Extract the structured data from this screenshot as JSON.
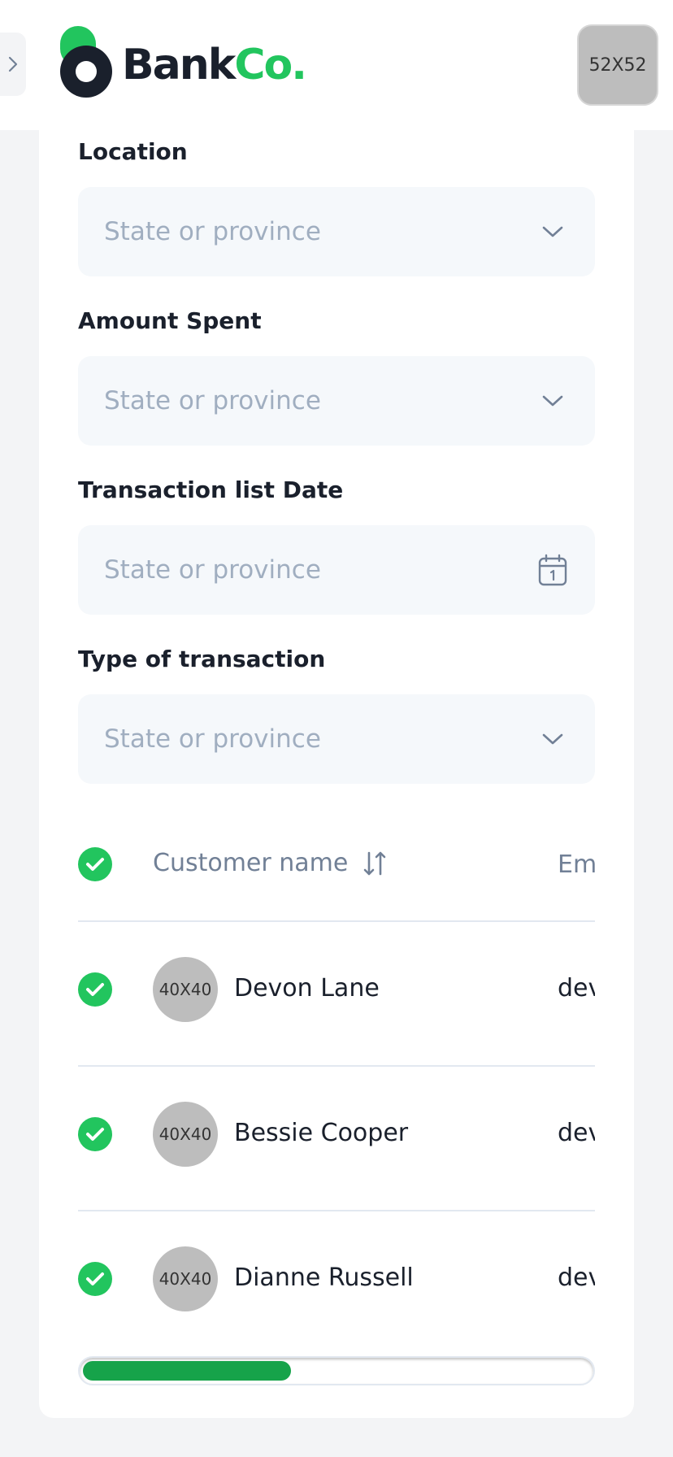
{
  "header": {
    "logo_bank": "Bank",
    "logo_co": "Co.",
    "avatar_label": "52X52"
  },
  "filters": [
    {
      "label": "Location",
      "placeholder": "State or province",
      "icon": "chevron-down-icon"
    },
    {
      "label": "Amount Spent",
      "placeholder": "State or province",
      "icon": "chevron-down-icon"
    },
    {
      "label": "Transaction list Date",
      "placeholder": "State or province",
      "icon": "calendar-icon"
    },
    {
      "label": "Type of transaction",
      "placeholder": "State or province",
      "icon": "chevron-down-icon"
    }
  ],
  "table": {
    "columns": {
      "name": "Customer name",
      "email": "Em"
    },
    "rows": [
      {
        "avatar": "40X40",
        "name": "Devon Lane",
        "email": "dev"
      },
      {
        "avatar": "40X40",
        "name": "Bessie Cooper",
        "email": "dev"
      },
      {
        "avatar": "40X40",
        "name": "Dianne Russell",
        "email": "dev"
      }
    ]
  },
  "scroll": {
    "progress": 0.41
  },
  "colors": {
    "accent": "#22c55e",
    "accent_dark": "#16a34a",
    "field_bg": "#f5f8fb",
    "placeholder": "#a0aec0"
  }
}
